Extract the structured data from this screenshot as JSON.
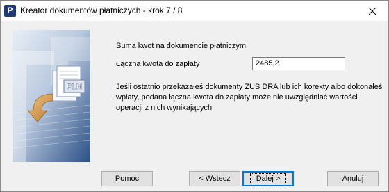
{
  "window": {
    "title": "Kreator dokumentów płatniczych - krok 7 / 8",
    "app_icon_letter": "P"
  },
  "side_image": {
    "badge_text": "PLN"
  },
  "content": {
    "section_title": "Suma kwot na dokumencie płatniczym",
    "total_label": "Łączna kwota  do zapłaty",
    "total_value": "2485,2",
    "info_text": "Jeśli ostatnio przekazałeś dokumenty ZUS DRA lub ich korekty albo dokonałeś wpłaty, podana łączna kwota do zapłaty może nie uwzględniać wartości operacji z nich wynikających"
  },
  "buttons": {
    "help": {
      "mnemonic": "P",
      "rest": "omoc"
    },
    "back": {
      "prefix": "< ",
      "mnemonic": "W",
      "rest": "stecz"
    },
    "next": {
      "mnemonic": "D",
      "rest": "alej >"
    },
    "cancel": {
      "mnemonic": "A",
      "rest": "nuluj"
    }
  }
}
